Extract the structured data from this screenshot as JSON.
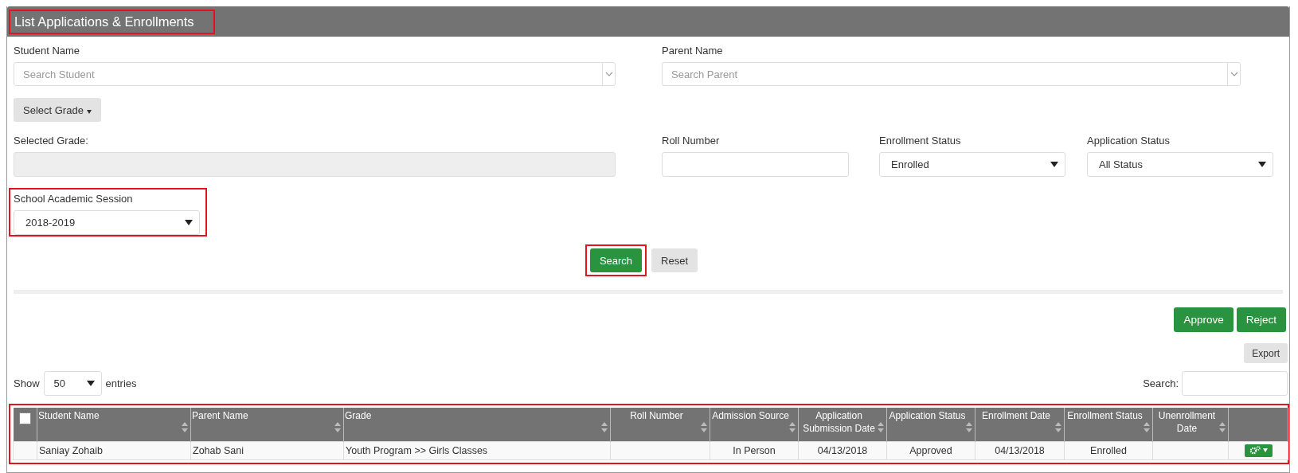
{
  "header": {
    "title": "List Applications & Enrollments",
    "highlighted": true
  },
  "student_name": {
    "label": "Student Name",
    "placeholder": "Search Student"
  },
  "parent_name": {
    "label": "Parent Name",
    "placeholder": "Search Parent"
  },
  "grade_button": {
    "label": "Select Grade"
  },
  "selected_grade": {
    "label": "Selected Grade:"
  },
  "roll_number": {
    "label": "Roll Number"
  },
  "enrollment_status": {
    "label": "Enrollment Status",
    "value": "Enrolled"
  },
  "application_status": {
    "label": "Application Status",
    "value": "All Status"
  },
  "session": {
    "label": "School Academic Session",
    "value": "2018-2019",
    "highlighted": true
  },
  "search_button": {
    "label": "Search",
    "highlighted": true
  },
  "reset_button": {
    "label": "Reset"
  },
  "approve_button": {
    "label": "Approve"
  },
  "reject_button": {
    "label": "Reject"
  },
  "export_button": {
    "label": "Export"
  },
  "length_menu": {
    "prefix": "Show",
    "value": "50",
    "suffix": "entries"
  },
  "table_search": {
    "label": "Search:"
  },
  "table": {
    "highlighted": true,
    "select_all": {
      "checked": false
    },
    "columns": [
      {
        "label": "Student Name",
        "sortable": true
      },
      {
        "label": "Parent Name",
        "sortable": true
      },
      {
        "label": "Grade",
        "sortable": true
      },
      {
        "label": "Roll Number",
        "sortable": true
      },
      {
        "label": "Admission Source",
        "sortable": true
      },
      {
        "label": "Application Submission Date",
        "sortable": true
      },
      {
        "label": "Application Status",
        "sortable": true
      },
      {
        "label": "Enrollment Date",
        "sortable": true
      },
      {
        "label": "Enrollment Status",
        "sortable": true
      },
      {
        "label": "Unenrollment Date",
        "sortable": true
      }
    ],
    "rows": [
      {
        "cells": [
          "Saniay Zohaib",
          "Zohab Sani",
          "Youth Program >> Girls Classes",
          "",
          "In Person",
          "04/13/2018",
          "Approved",
          "04/13/2018",
          "Enrolled",
          ""
        ]
      }
    ]
  }
}
